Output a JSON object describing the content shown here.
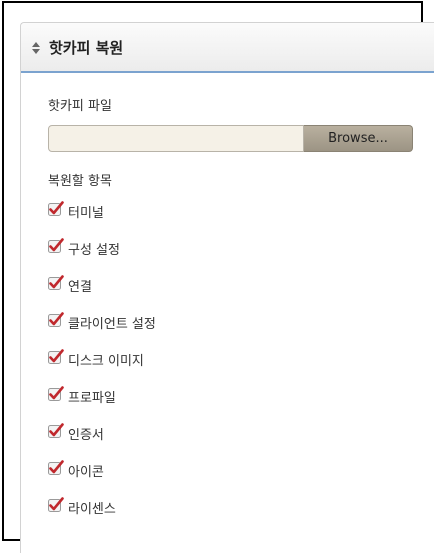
{
  "panel": {
    "title": "핫카피 복원"
  },
  "file": {
    "label": "핫카피 파일",
    "value": "",
    "browse_label": "Browse..."
  },
  "restore": {
    "label": "복원할 항목",
    "items": [
      {
        "label": "터미널",
        "checked": true
      },
      {
        "label": "구성 설정",
        "checked": true
      },
      {
        "label": "연결",
        "checked": true
      },
      {
        "label": "클라이언트 설정",
        "checked": true
      },
      {
        "label": "디스크 이미지",
        "checked": true
      },
      {
        "label": "프로파일",
        "checked": true
      },
      {
        "label": "인증서",
        "checked": true
      },
      {
        "label": "아이콘",
        "checked": true
      },
      {
        "label": "라이센스",
        "checked": true
      }
    ]
  },
  "colors": {
    "accent": "#7ba3cf",
    "check_mark": "#c0282d",
    "browse_button": "#a89f8f"
  }
}
